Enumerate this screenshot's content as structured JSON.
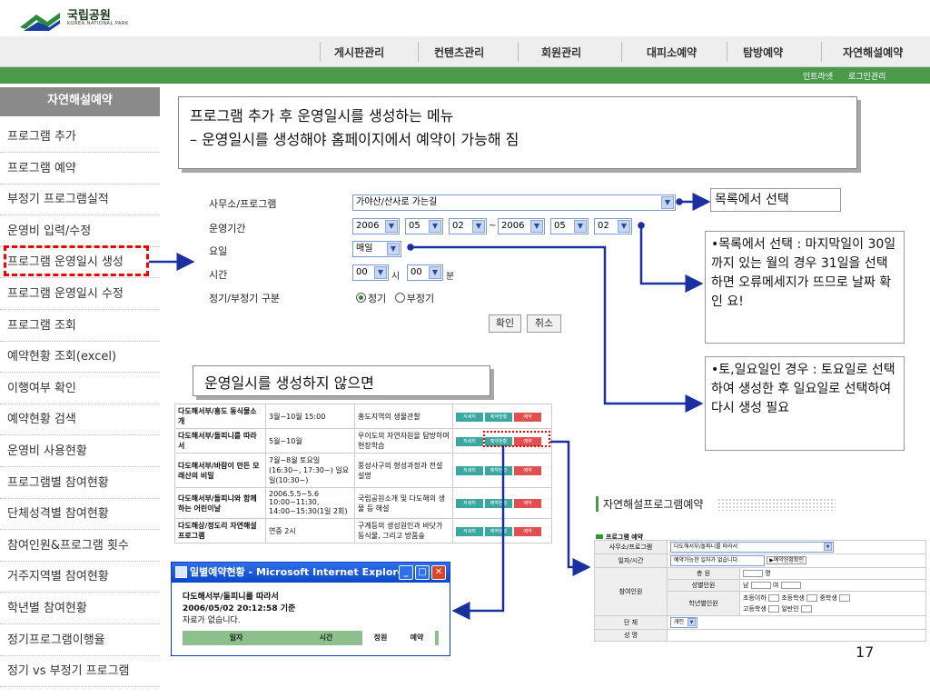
{
  "header": {
    "logo_ko": "국립공원",
    "logo_en": "KOREA NATIONAL PARK",
    "nav": [
      "게시판관리",
      "컨텐츠관리",
      "회원관리",
      "대피소예약",
      "탐방예약",
      "자연해설예약"
    ],
    "sublinks": [
      "인트라넷",
      "로그인관리"
    ]
  },
  "sidebar": {
    "title": "자연해설예약",
    "items": [
      "프로그램 추가",
      "프로그램 예약",
      "부정기 프로그램실적",
      "운영비 입력/수정",
      "프로그램 운영일시 생성",
      "프로그램 운영일시 수정",
      "프로그램 조회",
      "예약현황 조회(excel)",
      "이행여부 확인",
      "예약현황 검색",
      "운영비 사용현황",
      "프로그램별 참여현황",
      "단체성격별 참여현황",
      "참여인원&프로그램 횟수",
      "거주지역별 참여현황",
      "학년별 참여현황",
      "정기프로그램이행율",
      "정기 vs 부정기 프로그램"
    ]
  },
  "callout_top": {
    "line1": "프로그램 추가 후 운영일시를 생성하는 메뉴",
    "line2": " – 운영일시를 생성해야 홈페이지에서 예약이 가능해 짐"
  },
  "callout_mid": "운영일시를 생성하지 않으면",
  "form": {
    "labels": {
      "office": "사무소/프로그램",
      "period": "운영기간",
      "weekday": "요일",
      "time": "시간",
      "regular": "정기/부정기 구분"
    },
    "program_value": "가야산/산사로 가는길",
    "start_year": "2006",
    "start_month": "05",
    "start_day": "02",
    "tilde": "~",
    "end_year": "2006",
    "end_month": "05",
    "end_day": "02",
    "weekday_value": "매일",
    "hour": "00",
    "hour_unit": "시",
    "minute": "00",
    "minute_unit": "분",
    "radio_regular": "정기",
    "radio_irregular": "부정기",
    "confirm": "확인",
    "cancel": "취소"
  },
  "notes": {
    "note1": "목록에서 선택",
    "note2": "•목록에서 선택 : 마지막일이 30일까지 있는 월의 경우 31일을 선택하면 오류메세지가 뜨므로 날짜 확인 요!",
    "note3": "•토,일요일인 경우 : 토요일로 선택하여 생성한 후 일요일로 선택하여 다시 생성 필요"
  },
  "program_table": {
    "rows": [
      {
        "name": "다도해서부/홍도 동식물소개",
        "time": "3월~10월 15:00",
        "desc": "홍도지역의 생물관찰"
      },
      {
        "name": "다도해서부/돌피니를 따라서",
        "time": "5월~10월",
        "desc": "우이도의 자연자원을 탐방하며 현장학습"
      },
      {
        "name": "다도해서부/바람이 만든 모래산의 비밀",
        "time": "7월~8월 토요일 (16:30~, 17:30~) 일요일(10:30~)",
        "desc": "풍성사구의 형성과정과 전설 설명"
      },
      {
        "name": "다도해서부/돌피니와 함께하는 어린이날",
        "time": "2006.5.5~5.6 10:00~11:30, 14:00~15:30(1일 2회)",
        "desc": "국립공원소개 및 다도해의 생물 등 해설"
      },
      {
        "name": "다도해상/정도리 자연해설프로그램",
        "time": "연중 2시",
        "desc": "구계등의 생성원인과 바닷가 동식물, 그리고 방품숲"
      }
    ],
    "tags": [
      "자세히",
      "예약현황",
      "예약"
    ]
  },
  "ie_window": {
    "title": "일별예약현황 - Microsoft Internet Explorer",
    "program": "다도해서부/돌피니를 따라서",
    "timestamp": "2006/05/02 20:12:58 기준",
    "empty": "자료가 없습니다.",
    "cols": [
      "일자",
      "시간",
      "정원",
      "예약"
    ]
  },
  "result_panel": {
    "title": "자연해설프로그램예약",
    "subtitle": "프로그램 예약",
    "row_office_label": "사무소/프로그램",
    "row_office_value": "다도해서부/돌피니를 따라서",
    "row_date_label": "일자/시간",
    "row_date_value": "예약가능한 일자가 없습니다.",
    "row_date_btn": "▶예약현황확인",
    "participants_label": "참여인원",
    "total_label": "총 원",
    "total_unit": "명",
    "gender_label": "성별인원",
    "male": "남",
    "female": "여",
    "grade_label": "학년별인원",
    "grades1": [
      "초등이하",
      "초등학생",
      "중학생"
    ],
    "grades2": [
      "고등학생",
      "일반인"
    ],
    "group_label": "단 체",
    "group_value": "개인",
    "next_label": "성 명"
  },
  "page_number": "17",
  "colors": {
    "green": "#4b9a4b",
    "red": "#e00000",
    "blue": "#1a2fa0"
  }
}
